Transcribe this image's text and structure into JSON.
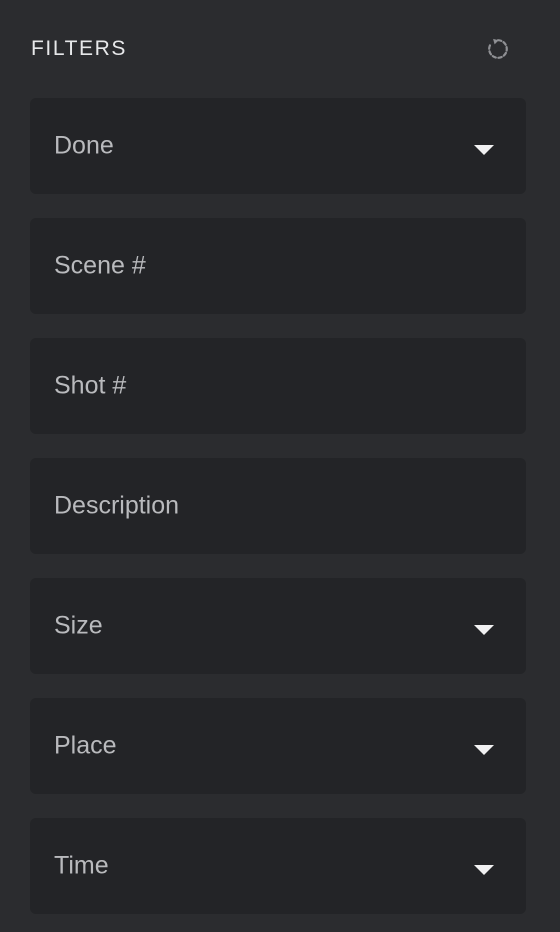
{
  "header": {
    "title": "FILTERS",
    "reset_icon": "reset-icon"
  },
  "filters": [
    {
      "label": "Done",
      "type": "select",
      "icon": "chevron-down-icon"
    },
    {
      "label": "Scene #",
      "type": "input"
    },
    {
      "label": "Shot #",
      "type": "input"
    },
    {
      "label": "Description",
      "type": "input"
    },
    {
      "label": "Size",
      "type": "select",
      "icon": "chevron-down-icon"
    },
    {
      "label": "Place",
      "type": "select",
      "icon": "chevron-down-icon"
    },
    {
      "label": "Time",
      "type": "select",
      "icon": "chevron-down-icon"
    }
  ],
  "colors": {
    "panel_bg": "#2b2c2f",
    "field_bg": "#232427",
    "text": "#b9babd",
    "title": "#e7e8ea"
  }
}
